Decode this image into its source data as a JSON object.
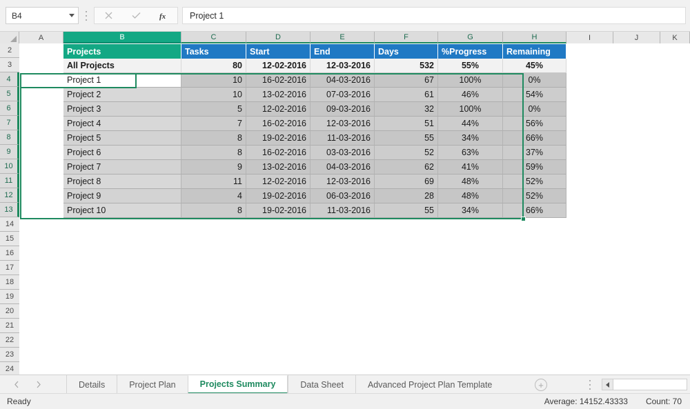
{
  "formula_bar": {
    "name_box_value": "B4",
    "cancel_icon": "close-icon",
    "enter_icon": "check-icon",
    "function_icon": "fx-icon",
    "formula_value": "Project 1"
  },
  "grid": {
    "column_headers": [
      "A",
      "B",
      "C",
      "D",
      "E",
      "F",
      "G",
      "H",
      "I",
      "J",
      "K"
    ],
    "active_column": "B",
    "selected_columns": [
      "B",
      "C",
      "D",
      "E",
      "F",
      "G",
      "H"
    ],
    "row_headers": [
      "2",
      "3",
      "4",
      "5",
      "6",
      "7",
      "8",
      "9",
      "10",
      "11",
      "12",
      "13",
      "14",
      "15",
      "16",
      "17",
      "18",
      "19",
      "20",
      "21",
      "22",
      "23",
      "24"
    ],
    "selected_rows": [
      "4",
      "5",
      "6",
      "7",
      "8",
      "9",
      "10",
      "11",
      "12",
      "13"
    ],
    "table_headers": [
      "Projects",
      "Tasks",
      "Start",
      "End",
      "Days",
      "%Progress",
      "Remaining"
    ],
    "total_row": {
      "name": "All Projects",
      "tasks": "80",
      "start": "12-02-2016",
      "end": "12-03-2016",
      "days": "532",
      "progress": "55%",
      "remaining": "45%"
    },
    "rows": [
      {
        "name": "Project 1",
        "tasks": "10",
        "start": "16-02-2016",
        "end": "04-03-2016",
        "days": "67",
        "progress": "100%",
        "remaining": "0%"
      },
      {
        "name": "Project 2",
        "tasks": "10",
        "start": "13-02-2016",
        "end": "07-03-2016",
        "days": "61",
        "progress": "46%",
        "remaining": "54%"
      },
      {
        "name": "Project 3",
        "tasks": "5",
        "start": "12-02-2016",
        "end": "09-03-2016",
        "days": "32",
        "progress": "100%",
        "remaining": "0%"
      },
      {
        "name": "Project 4",
        "tasks": "7",
        "start": "16-02-2016",
        "end": "12-03-2016",
        "days": "51",
        "progress": "44%",
        "remaining": "56%"
      },
      {
        "name": "Project 5",
        "tasks": "8",
        "start": "19-02-2016",
        "end": "11-03-2016",
        "days": "55",
        "progress": "34%",
        "remaining": "66%"
      },
      {
        "name": "Project 6",
        "tasks": "8",
        "start": "16-02-2016",
        "end": "03-03-2016",
        "days": "52",
        "progress": "63%",
        "remaining": "37%"
      },
      {
        "name": "Project 7",
        "tasks": "9",
        "start": "13-02-2016",
        "end": "04-03-2016",
        "days": "62",
        "progress": "41%",
        "remaining": "59%"
      },
      {
        "name": "Project 8",
        "tasks": "11",
        "start": "12-02-2016",
        "end": "12-03-2016",
        "days": "69",
        "progress": "48%",
        "remaining": "52%"
      },
      {
        "name": "Project 9",
        "tasks": "4",
        "start": "19-02-2016",
        "end": "06-03-2016",
        "days": "28",
        "progress": "48%",
        "remaining": "52%"
      },
      {
        "name": "Project 10",
        "tasks": "8",
        "start": "19-02-2016",
        "end": "11-03-2016",
        "days": "55",
        "progress": "34%",
        "remaining": "66%"
      }
    ],
    "active_cell": "B4",
    "header_green": "#13a884",
    "header_blue": "#2079c4",
    "selection_green": "#1e8a5f"
  },
  "sheet_tabs": {
    "prev_icon": "chevron-left-icon",
    "next_icon": "chevron-right-icon",
    "tabs": [
      {
        "label": "Details",
        "active": false
      },
      {
        "label": "Project Plan",
        "active": false
      },
      {
        "label": "Projects Summary",
        "active": true
      },
      {
        "label": "Data Sheet",
        "active": false
      },
      {
        "label": "Advanced Project Plan Template",
        "active": false
      }
    ],
    "add_sheet_label": "+",
    "add_sheet_icon": "plus-circle-icon"
  },
  "status_bar": {
    "mode": "Ready",
    "average": "Average: 14152.43333",
    "count": "Count: 70"
  }
}
